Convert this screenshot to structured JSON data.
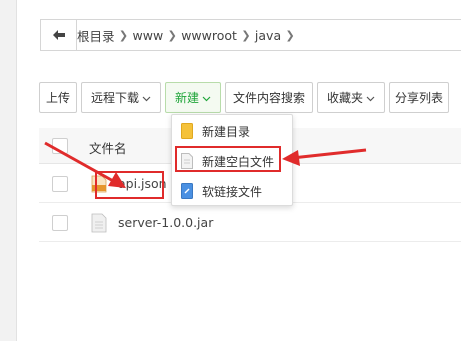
{
  "breadcrumb": {
    "back_icon": "arrow-left-icon",
    "items": [
      "根目录",
      "www",
      "wwwroot",
      "java"
    ]
  },
  "toolbar": {
    "upload": "上传",
    "remote_download": "远程下载",
    "new": "新建",
    "content_search": "文件内容搜索",
    "favorites": "收藏夹",
    "share_list": "分享列表"
  },
  "table": {
    "header_name": "文件名",
    "rows": [
      {
        "name": "api.json",
        "icon": "json-file-icon"
      },
      {
        "name": "server-1.0.0.jar",
        "icon": "file-icon"
      }
    ]
  },
  "new_menu": {
    "items": [
      {
        "label": "新建目录",
        "icon": "folder-icon"
      },
      {
        "label": "新建空白文件",
        "icon": "blank-file-icon"
      },
      {
        "label": "软链接文件",
        "icon": "link-file-icon"
      }
    ]
  },
  "colors": {
    "accent_green": "#20a53a",
    "annotation_red": "#e02b2b",
    "folder_yellow": "#f5c23a"
  }
}
